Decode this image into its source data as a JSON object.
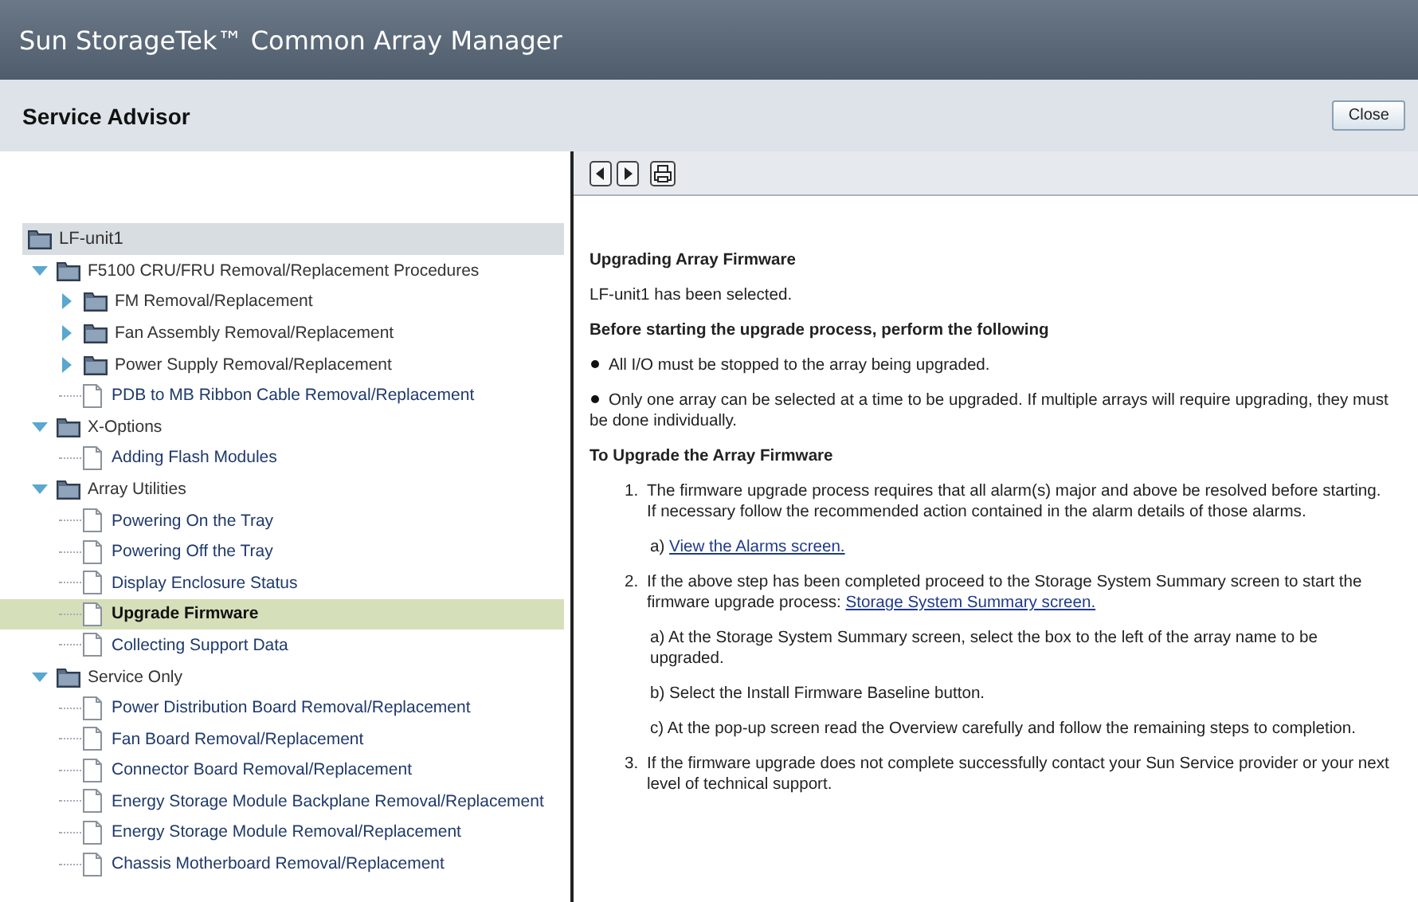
{
  "window": {
    "title": "Sun StorageTek™ Common Array Manager"
  },
  "header": {
    "title": "Service Advisor",
    "close_button": "Close"
  },
  "toolbar": {
    "buttons": [
      {
        "kind": "back"
      },
      {
        "kind": "forward"
      },
      {
        "kind": "print"
      }
    ]
  },
  "tree": {
    "root": {
      "label": "LF-unit1"
    },
    "children": [
      {
        "kind": "folder",
        "label": "F5100 CRU/FRU Removal/Replacement Procedures",
        "expanded": true,
        "selected": false,
        "children": [
          {
            "kind": "folder",
            "label": "FM Removal/Replacement",
            "expanded": false,
            "selected": false
          },
          {
            "kind": "folder",
            "label": "Fan Assembly Removal/Replacement",
            "expanded": false,
            "selected": false
          },
          {
            "kind": "folder",
            "label": "Power Supply Removal/Replacement",
            "expanded": false,
            "selected": false
          },
          {
            "kind": "doc",
            "label": "PDB to MB Ribbon Cable Removal/Replacement",
            "selected": false
          }
        ]
      },
      {
        "kind": "folder",
        "label": "X-Options",
        "expanded": true,
        "selected": false,
        "children": [
          {
            "kind": "doc",
            "label": "Adding Flash Modules",
            "selected": false
          }
        ]
      },
      {
        "kind": "folder",
        "label": "Array Utilities",
        "expanded": true,
        "selected": false,
        "children": [
          {
            "kind": "doc",
            "label": "Powering On the Tray",
            "selected": false
          },
          {
            "kind": "doc",
            "label": "Powering Off the Tray",
            "selected": false
          },
          {
            "kind": "doc",
            "label": "Display Enclosure Status",
            "selected": false
          },
          {
            "kind": "doc",
            "label": "Upgrade Firmware",
            "selected": true
          },
          {
            "kind": "doc",
            "label": "Collecting Support Data",
            "selected": false
          }
        ]
      },
      {
        "kind": "folder",
        "label": "Service Only",
        "expanded": true,
        "selected": false,
        "children": [
          {
            "kind": "doc",
            "label": "Power Distribution Board Removal/Replacement",
            "selected": false
          },
          {
            "kind": "doc",
            "label": "Fan Board Removal/Replacement",
            "selected": false
          },
          {
            "kind": "doc",
            "label": "Connector Board Removal/Replacement",
            "selected": false
          },
          {
            "kind": "doc",
            "label": "Energy Storage Module Backplane Removal/Replacement",
            "selected": false
          },
          {
            "kind": "doc",
            "label": "Energy Storage Module Removal/Replacement",
            "selected": false
          },
          {
            "kind": "doc",
            "label": "Chassis Motherboard Removal/Replacement",
            "selected": false
          }
        ]
      }
    ]
  },
  "content": {
    "title": "Upgrading Array Firmware",
    "selection_note": "LF-unit1 has been selected.",
    "prereq_heading": "Before starting the upgrade process, perform the following",
    "bullets": [
      "All I/O must be stopped to the array being upgraded.",
      "Only one array can be selected at a time to be upgraded. If multiple arrays will require upgrading, they must be done individually."
    ],
    "steps_heading": "To Upgrade the Array Firmware",
    "steps": [
      {
        "number": "1.",
        "text": "The firmware upgrade process requires that all alarm(s) major and above be resolved before starting. If necessary follow the recommended action contained in the alarm details of those alarms.",
        "substeps": [
          {
            "text": "a)",
            "link": "View the Alarms screen."
          }
        ]
      },
      {
        "number": "2.",
        "text": "If the above step has been completed proceed to the Storage System Summary screen to start the firmware upgrade process:",
        "link": "Storage System Summary screen.",
        "substeps": [
          {
            "text": "a) At the Storage System Summary screen, select the box to the left of the array name to be upgraded."
          },
          {
            "text": "b) Select the Install Firmware Baseline button."
          },
          {
            "text": "c) At the pop-up screen read the Overview carefully and follow the remaining steps to completion."
          }
        ]
      },
      {
        "number": "3.",
        "text": "If the firmware upgrade does not complete successfully contact your Sun Service provider or your next level of technical support."
      }
    ]
  }
}
